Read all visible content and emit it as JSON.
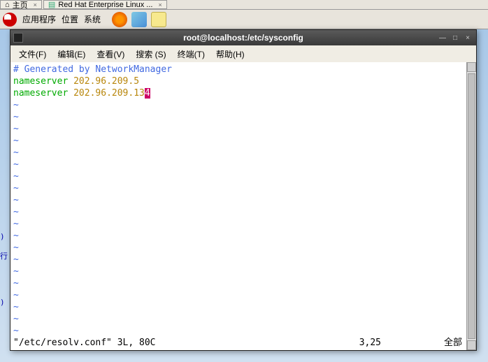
{
  "taskbar": {
    "items": [
      {
        "label": "主页"
      },
      {
        "label": "Red Hat Enterprise Linux ..."
      }
    ]
  },
  "panel": {
    "apps": "应用程序",
    "places": "位置",
    "system": "系统"
  },
  "terminal": {
    "title": "root@localhost:/etc/sysconfig",
    "menu": {
      "file": "文件(F)",
      "edit": "编辑(E)",
      "view": "查看(V)",
      "search": "搜索 (S)",
      "terminal": "终端(T)",
      "help": "帮助(H)"
    },
    "content": {
      "line1_comment": "# Generated by NetworkManager",
      "line2_kw": "nameserver",
      "line2_val": "202.96.209.5",
      "line3_kw": "nameserver",
      "line3_val_a": "202.96.209.13",
      "line3_val_b": "4"
    },
    "status": {
      "left": "\"/etc/resolv.conf\" 3L, 80C",
      "mid": "3,25",
      "right": "全部"
    }
  }
}
